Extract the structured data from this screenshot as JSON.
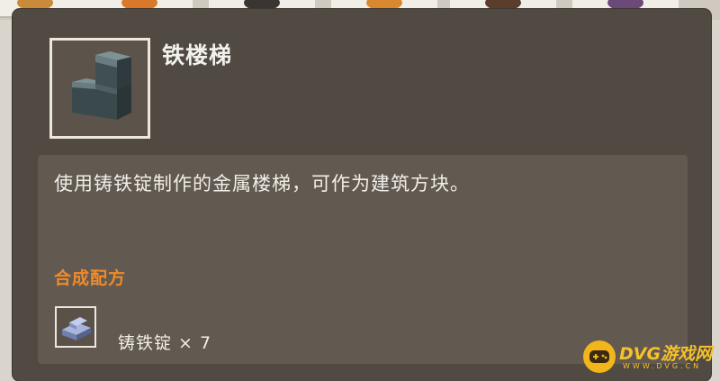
{
  "item": {
    "name": "铁楼梯",
    "icon": "iron-stairs-icon"
  },
  "description": "使用铸铁锭制作的金属楼梯，可作为建筑方块。",
  "recipe": {
    "title": "合成配方",
    "ingredients": [
      {
        "icon": "cast-iron-ingot-icon",
        "label": "铸铁锭 × 7"
      }
    ]
  },
  "watermark": {
    "text": "DVG游戏网",
    "sub": "WWW.DVG.CN"
  },
  "colors": {
    "panel": "#514a42",
    "desc_box": "#625a50",
    "recipe_title": "#f08a2a",
    "watermark": "#f6c12a"
  }
}
